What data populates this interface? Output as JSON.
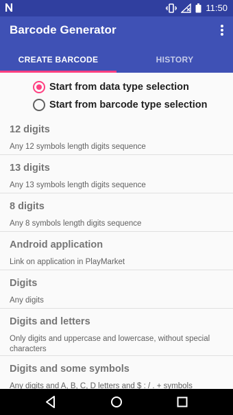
{
  "status_bar": {
    "notification_icon": "n-icon",
    "time": "11:50",
    "icons": [
      "vibrate-icon",
      "wifi-off-icon",
      "battery-icon"
    ]
  },
  "app_bar": {
    "title": "Barcode Generator",
    "overflow_icon": "more-vertical-icon"
  },
  "tabs": [
    {
      "label": "CREATE BARCODE",
      "active": true
    },
    {
      "label": "HISTORY",
      "active": false
    }
  ],
  "mode": {
    "options": [
      {
        "label": "Start from data type selection",
        "checked": true
      },
      {
        "label": "Start from barcode type selection",
        "checked": false
      }
    ]
  },
  "data_types": [
    {
      "name": "12 digits",
      "desc": "Any 12 symbols length digits sequence"
    },
    {
      "name": "13 digits",
      "desc": "Any 13 symbols length digits sequence"
    },
    {
      "name": "8 digits",
      "desc": "Any 8 symbols length digits sequence"
    },
    {
      "name": "Android application",
      "desc": "Link on application in PlayMarket"
    },
    {
      "name": "Digits",
      "desc": "Any digits"
    },
    {
      "name": "Digits and letters",
      "desc": "Only digits and uppercase and lowercase, without special characters"
    },
    {
      "name": "Digits and some symbols",
      "desc": "Any digits and A, B, C, D letters and $ : / . + symbols"
    }
  ],
  "nav_bar": {
    "icons": [
      "back-icon",
      "home-icon",
      "recents-icon"
    ]
  },
  "colors": {
    "primary": "#3f51b5",
    "primary_dark": "#303f9f",
    "accent": "#ff4081"
  }
}
